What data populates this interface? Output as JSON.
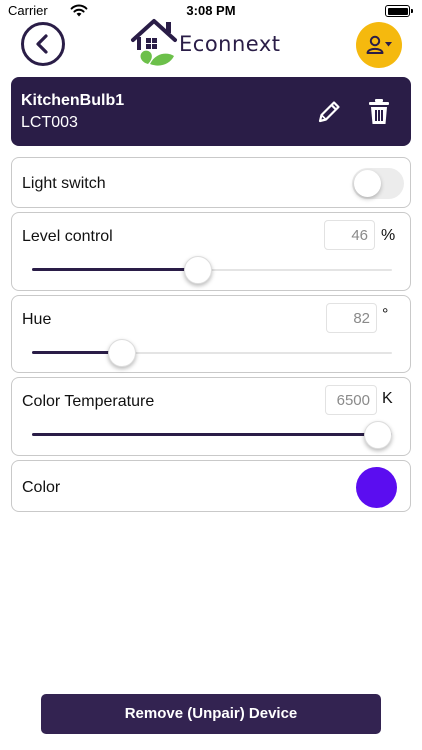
{
  "status_bar": {
    "carrier": "Carrier",
    "time": "3:08 PM",
    "wifi_icon": "wifi-icon",
    "battery_icon": "battery-icon"
  },
  "header": {
    "back_icon": "chevron-left-icon",
    "logo_text": "Econnext",
    "profile_icon": "user-dropdown-icon"
  },
  "device": {
    "name": "KitchenBulb1",
    "model": "LCT003",
    "edit_icon": "pencil-icon",
    "delete_icon": "trash-icon"
  },
  "controls": {
    "light_switch": {
      "label": "Light switch",
      "on": false
    },
    "level": {
      "label": "Level control",
      "value": "46",
      "unit": "%",
      "fraction": 0.46
    },
    "hue": {
      "label": "Hue",
      "value": "82",
      "unit": "°",
      "fraction": 0.25
    },
    "color_temperature": {
      "label": "Color Temperature",
      "value": "6500",
      "unit": "K",
      "fraction": 1.0
    },
    "color": {
      "label": "Color",
      "hex": "#5b0df0"
    }
  },
  "actions": {
    "remove_label": "Remove (Unpair) Device"
  },
  "colors": {
    "primary": "#2a1d47",
    "accent": "#f5b90e",
    "leaf_green": "#6cc04a"
  }
}
